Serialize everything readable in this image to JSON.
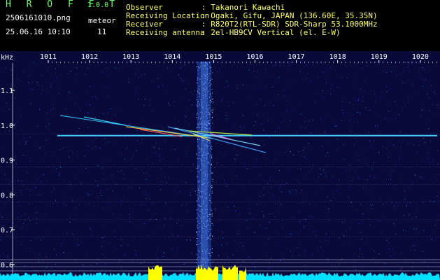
{
  "header": {
    "app_title": "H R O F F T",
    "app_version": "1.0.0",
    "filename": "2506161010.png",
    "datetime": "25.06.16 10:10",
    "meteor_label": "meteor",
    "meteor_count": "11"
  },
  "info": [
    {
      "key": "Observer",
      "value": ": Takanori Kawachi"
    },
    {
      "key": "Receiving Location",
      "value": ": Ogaki, Gifu, JAPAN (136.60E, 35.35N)"
    },
    {
      "key": "Receiver",
      "value": ": R820T2(RTL-SDR) SDR-Sharp 53.1000MHz"
    },
    {
      "key": "Receiving antenna",
      "value": ": 2el-HB9CV Vertical (el. E-W)"
    }
  ],
  "chart_data": {
    "type": "heatmap",
    "title": "",
    "y_unit_label": "kHz",
    "x_tick_labels": [
      "1011",
      "1012",
      "1013",
      "1014",
      "1015",
      "1016",
      "1017",
      "1018",
      "1019",
      "1020"
    ],
    "y_tick_labels": [
      "1.1",
      "1.0",
      "0.9",
      "0.8",
      "0.7",
      "0.6"
    ],
    "ylim": [
      0.58,
      1.16
    ],
    "carrier_frequency_khz": 0.97,
    "colors": {
      "background": "#0a0a3a",
      "carrier": "#40c8ff",
      "meteor": "#c8ff40",
      "signal_column": "#3070ff",
      "peak": "#ffff00",
      "base": "#00e0ff",
      "ticks": "#ffffff"
    }
  }
}
